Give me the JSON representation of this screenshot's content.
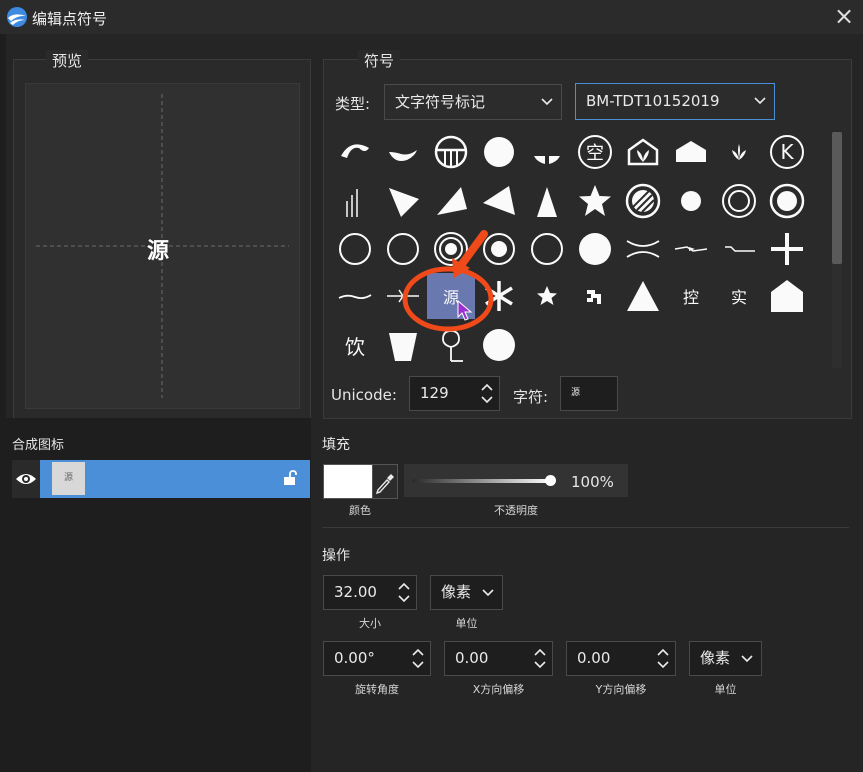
{
  "window": {
    "title": "编辑点符号",
    "close_icon": "×"
  },
  "preview": {
    "group_title": "预览",
    "glyph": "源"
  },
  "symbol": {
    "group_title": "符号",
    "type_label": "类型:",
    "type_value": "文字符号标记",
    "font_value": "BM-TDT10152019",
    "text_glyphs": {
      "selected": "源",
      "kong": "空",
      "k": "K",
      "kong2": "控",
      "shi": "实",
      "yin": "饮"
    },
    "unicode_label": "Unicode:",
    "unicode_value": "129",
    "char_label": "字符:",
    "char_value": "源"
  },
  "layers": {
    "title": "合成图标",
    "item_thumb": "源"
  },
  "fill": {
    "title": "填充",
    "color_label": "颜色",
    "color_value": "#ffffff",
    "opacity_label": "不透明度",
    "opacity_value": "100%",
    "opacity_fraction": 1.0
  },
  "ops": {
    "title": "操作",
    "size_value": "32.00",
    "size_label": "大小",
    "unit1_value": "像素",
    "unit1_label": "单位",
    "rotation_value": "0.00°",
    "rotation_label": "旋转角度",
    "xoffset_value": "0.00",
    "xoffset_label": "X方向偏移",
    "yoffset_value": "0.00",
    "yoffset_label": "Y方向偏移",
    "unit2_value": "像素",
    "unit2_label": "单位"
  },
  "colors": {
    "accent": "#4a8fd8",
    "annotation": "#f04a1a",
    "selected_cell": "#6a78b0"
  }
}
